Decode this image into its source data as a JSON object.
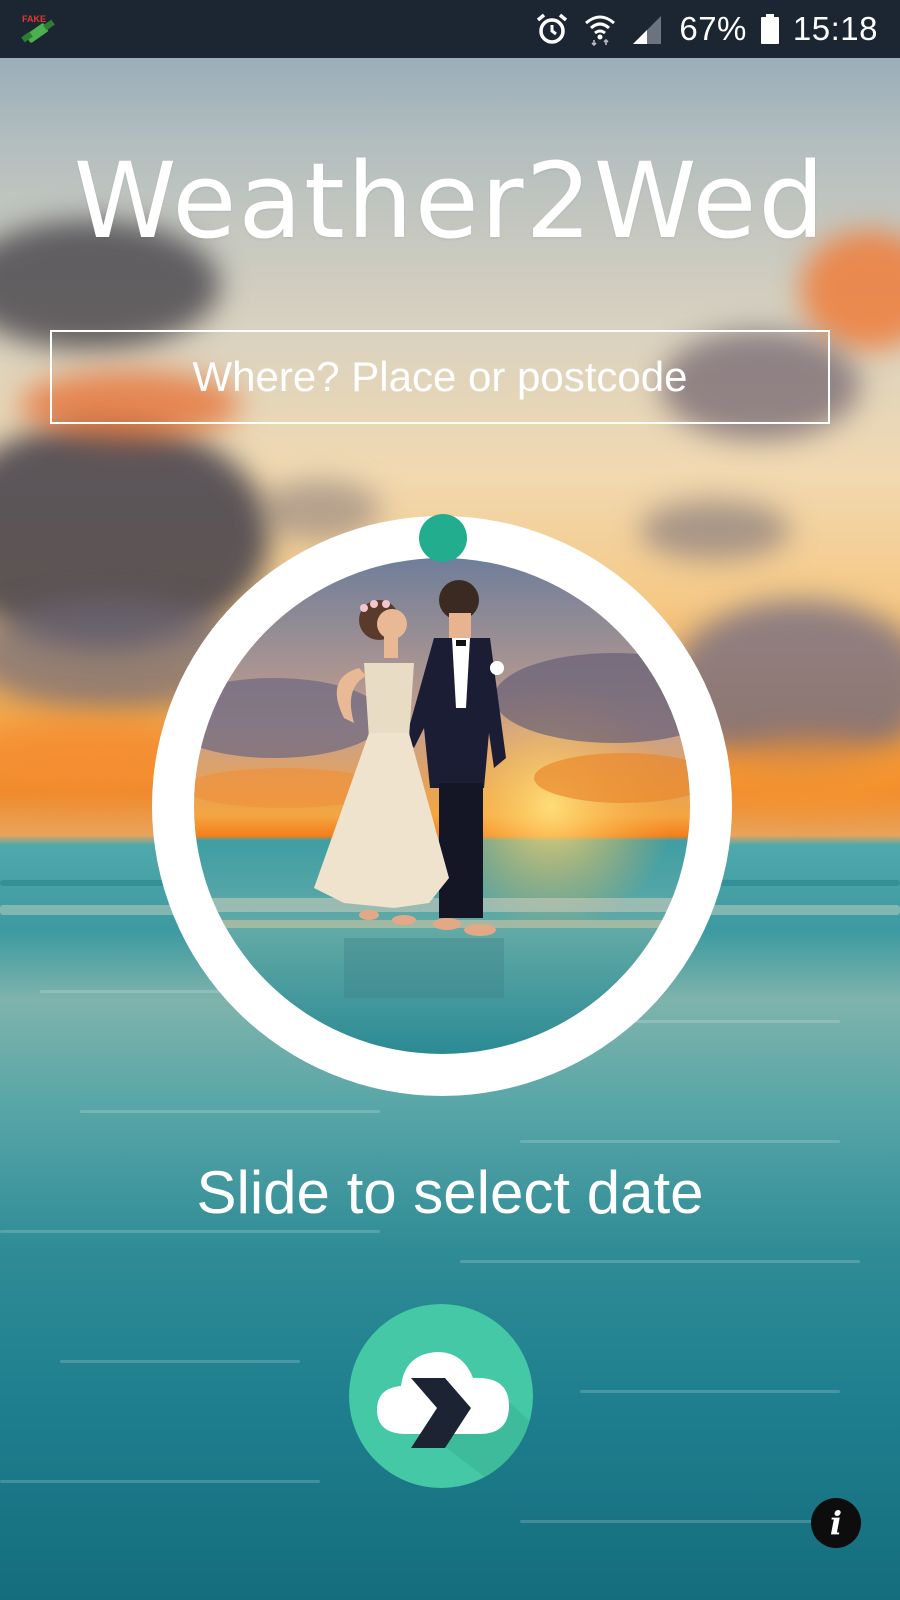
{
  "statusbar": {
    "battery_percent": "67%",
    "time": "15:18",
    "icons": [
      "fake-gps-icon",
      "alarm-icon",
      "wifi-icon",
      "signal-icon",
      "battery-icon"
    ]
  },
  "app": {
    "title": "Weather2Wed",
    "search_placeholder": "Where? Place or postcode",
    "slider_hint": "Slide to select date",
    "accent_color": "#21ad8e",
    "button_color": "#45c8a6"
  },
  "buttons": {
    "go_icon": "cloud-arrow-icon",
    "info_icon": "info-icon",
    "info_label": "i"
  }
}
